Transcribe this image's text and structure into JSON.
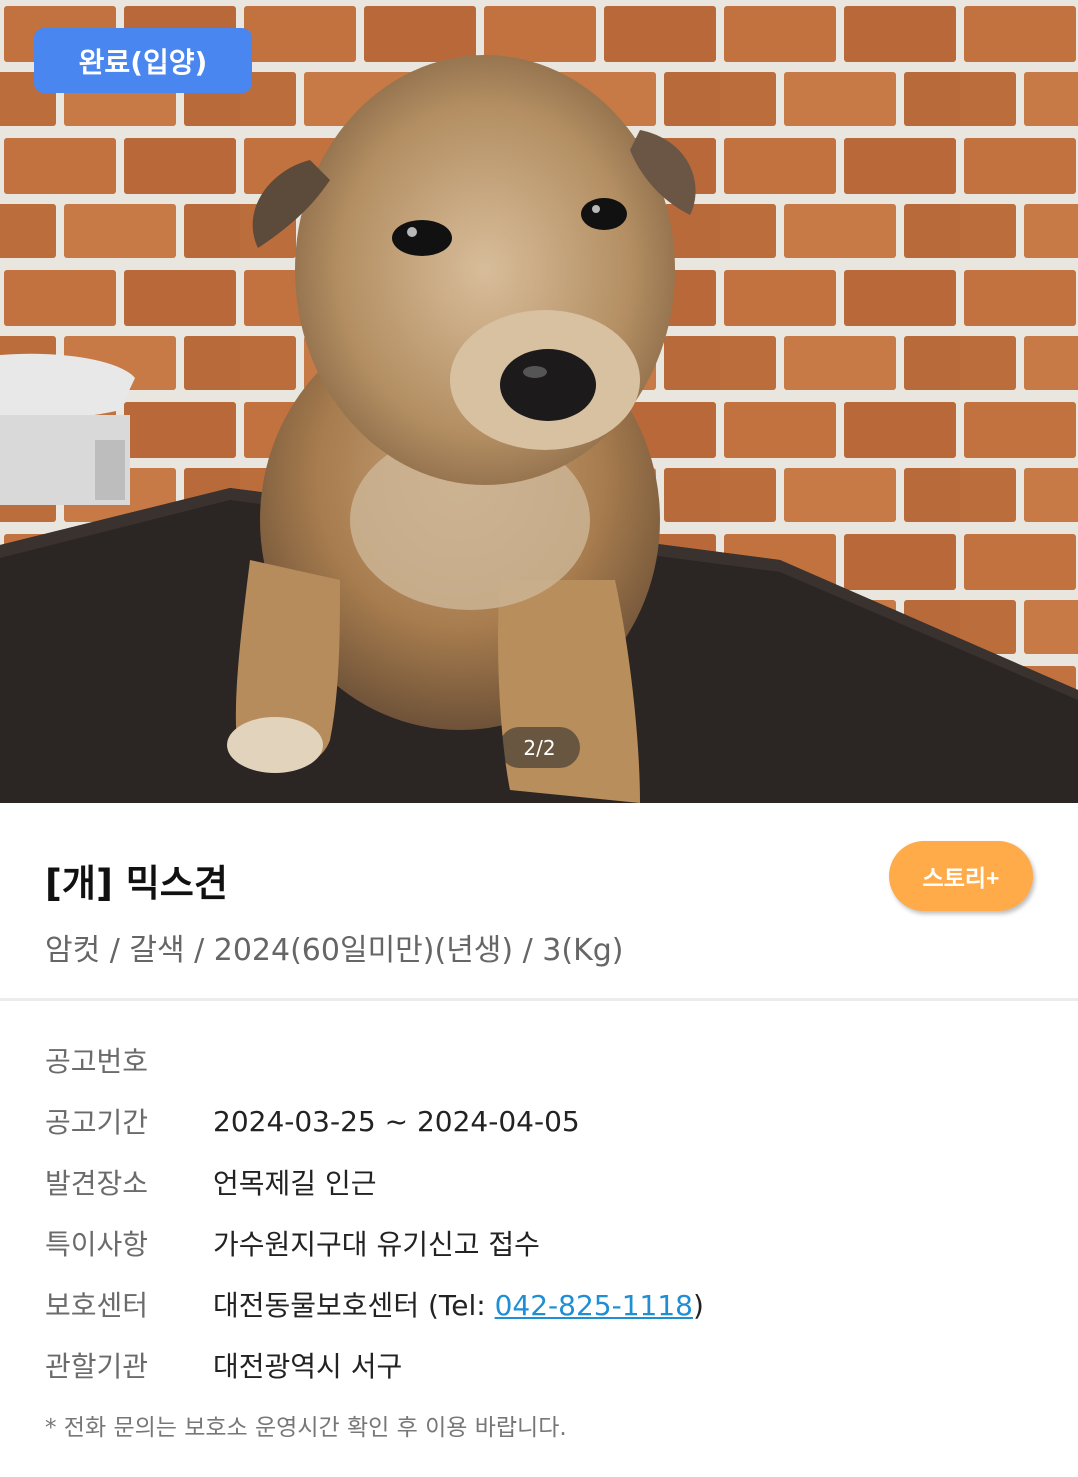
{
  "photo": {
    "status_badge": "완료(입양)",
    "page_counter": "2/2",
    "subject_icon": "puppy-photo"
  },
  "animal": {
    "title": "[개] 믹스견",
    "summary": "암컷 / 갈색 / 2024(60일미만)(년생) / 3(Kg)",
    "story_button": "스토리+"
  },
  "details": {
    "notice_number_label": "공고번호",
    "notice_number_value": "",
    "notice_period_label": "공고기간",
    "notice_period_value": "2024-03-25 ~ 2024-04-05",
    "found_place_label": "발견장소",
    "found_place_value": "언목제길 인근",
    "special_notes_label": "특이사항",
    "special_notes_value": "가수원지구대 유기신고 접수",
    "shelter_label": "보호센터",
    "shelter_name": "대전동물보호센터 (Tel: ",
    "shelter_tel": "042-825-1118",
    "shelter_close": ")",
    "jurisdiction_label": "관할기관",
    "jurisdiction_value": "대전광역시 서구"
  },
  "footer": {
    "notice": "* 전화 문의는 보호소 운영시간 확인 후 이용 바랍니다."
  },
  "colors": {
    "badge": "#4a86f0",
    "story_button": "#ffab4a",
    "link": "#1e8fd5"
  }
}
